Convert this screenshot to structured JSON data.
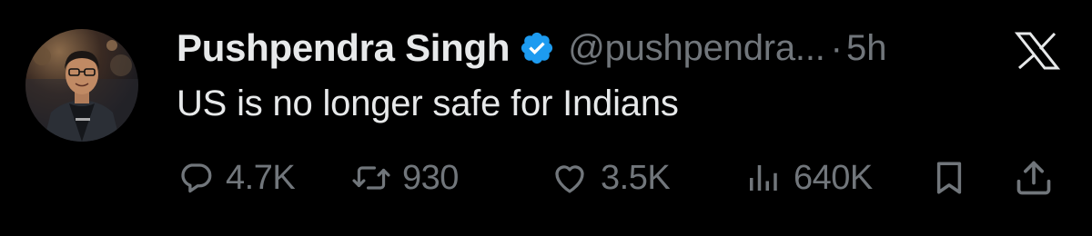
{
  "tweet": {
    "author_name": "Pushpendra Singh",
    "handle": "@pushpendra...",
    "separator": "·",
    "time": "5h",
    "text": "US is no longer safe for Indians",
    "verified": true
  },
  "actions": {
    "replies": "4.7K",
    "reposts": "930",
    "likes": "3.5K",
    "views": "640K"
  },
  "icons": {
    "avatar": "profile-photo",
    "verified": "verified-badge-icon",
    "logo": "x-logo-icon",
    "reply": "reply-icon",
    "repost": "repost-icon",
    "like": "heart-icon",
    "views": "views-icon",
    "bookmark": "bookmark-icon",
    "share": "share-icon"
  },
  "colors": {
    "background": "#000000",
    "primary_text": "#e7e9ea",
    "secondary_text": "#71767b",
    "verified_blue": "#1d9bf0"
  }
}
